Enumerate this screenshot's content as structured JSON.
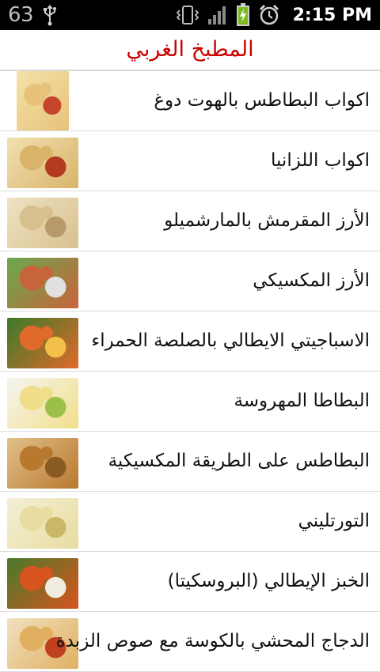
{
  "status_bar": {
    "notification_count": "63",
    "time": "2:15 PM",
    "icons": [
      "usb-icon",
      "vibrate-icon",
      "signal-icon",
      "battery-charging-icon",
      "alarm-icon"
    ]
  },
  "header": {
    "title": "المطبخ الغربي",
    "title_color": "#cc0000"
  },
  "recipes": [
    {
      "title": "اكواب البطاطس بالهوت دوغ",
      "thumb_colors": [
        "#e8c27a",
        "#c4452b",
        "#f3e2a8"
      ]
    },
    {
      "title": "اكواب اللزانيا",
      "thumb_colors": [
        "#d9b46a",
        "#b23a1e",
        "#f0e0b0"
      ]
    },
    {
      "title": "الأرز المقرمش بالمارشميلو",
      "thumb_colors": [
        "#d8c08e",
        "#b89a6a",
        "#eee2c2"
      ]
    },
    {
      "title": "الأرز المكسيكي",
      "thumb_colors": [
        "#c8643a",
        "#e0e0e0",
        "#6aa84f"
      ]
    },
    {
      "title": "الاسباجيتي الايطالي بالصلصة الحمراء",
      "thumb_colors": [
        "#e06a2a",
        "#f2c04a",
        "#3c7a2a"
      ]
    },
    {
      "title": "البطاطا المهروسة",
      "thumb_colors": [
        "#f1de8a",
        "#9cbf4a",
        "#f5f5f0"
      ]
    },
    {
      "title": "البطاطس على الطريقة المكسيكية",
      "thumb_colors": [
        "#b8782e",
        "#8a5a24",
        "#e2c08a"
      ]
    },
    {
      "title": "التورتليني",
      "thumb_colors": [
        "#e8dca0",
        "#c9b86a",
        "#f4efd6"
      ]
    },
    {
      "title": "الخبز الإيطالي (البروسكيتا)",
      "thumb_colors": [
        "#d8541e",
        "#f0ece0",
        "#4a7a2a"
      ]
    },
    {
      "title": "الدجاج المحشي بالكوسة مع صوص الزبدة",
      "thumb_colors": [
        "#e0b060",
        "#c04020",
        "#f0e0c0"
      ]
    }
  ]
}
